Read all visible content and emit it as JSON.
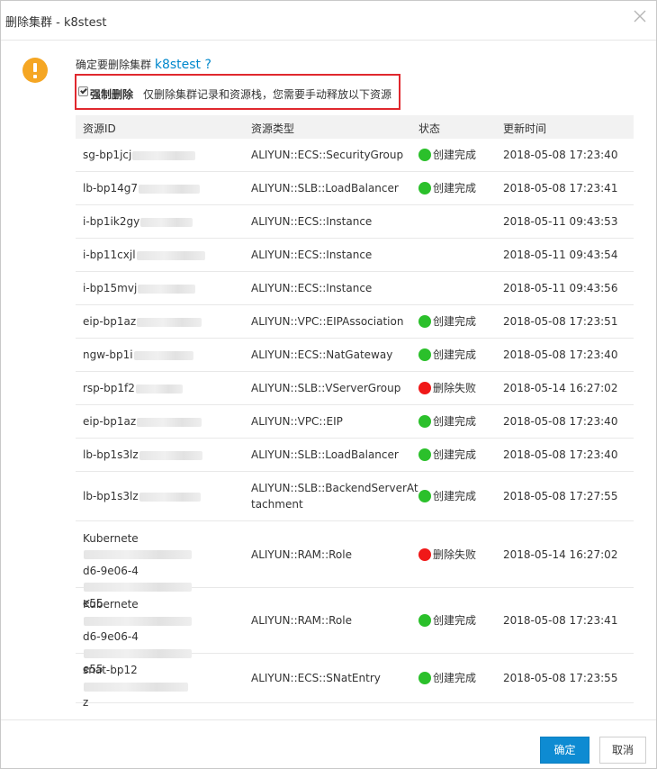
{
  "dialog": {
    "title": "删除集群 - k8stest",
    "question_prefix": "确定要删除集群",
    "cluster_name": "k8stest ?",
    "force_label": "强制删除",
    "force_desc": "仅删除集群记录和资源栈，您需要手动释放以下资源",
    "force_checked": true
  },
  "table": {
    "headers": {
      "id": "资源ID",
      "type": "资源类型",
      "status": "状态",
      "time": "更新时间"
    },
    "rows": [
      {
        "id_lines": [
          "sg-bp1jcj"
        ],
        "type_lines": [
          "ALIYUN::ECS::SecurityGroup"
        ],
        "status": "创建完成",
        "status_kind": "ok",
        "time": "2018-05-08 17:23:40"
      },
      {
        "id_lines": [
          "lb-bp14g7"
        ],
        "type_lines": [
          "ALIYUN::SLB::LoadBalancer"
        ],
        "status": "创建完成",
        "status_kind": "ok",
        "time": "2018-05-08 17:23:41"
      },
      {
        "id_lines": [
          "i-bp1ik2gy"
        ],
        "type_lines": [
          "ALIYUN::ECS::Instance"
        ],
        "status": "",
        "status_kind": "none",
        "time": "2018-05-11 09:43:53"
      },
      {
        "id_lines": [
          "i-bp11cxjl"
        ],
        "type_lines": [
          "ALIYUN::ECS::Instance"
        ],
        "status": "",
        "status_kind": "none",
        "time": "2018-05-11 09:43:54"
      },
      {
        "id_lines": [
          "i-bp15mvj"
        ],
        "type_lines": [
          "ALIYUN::ECS::Instance"
        ],
        "status": "",
        "status_kind": "none",
        "time": "2018-05-11 09:43:56"
      },
      {
        "id_lines": [
          "eip-bp1az"
        ],
        "type_lines": [
          "ALIYUN::VPC::EIPAssociation"
        ],
        "status": "创建完成",
        "status_kind": "ok",
        "time": "2018-05-08 17:23:51"
      },
      {
        "id_lines": [
          "ngw-bp1i"
        ],
        "type_lines": [
          "ALIYUN::ECS::NatGateway"
        ],
        "status": "创建完成",
        "status_kind": "ok",
        "time": "2018-05-08 17:23:40"
      },
      {
        "id_lines": [
          "rsp-bp1f2"
        ],
        "type_lines": [
          "ALIYUN::SLB::VServerGroup"
        ],
        "status": "删除失败",
        "status_kind": "fail",
        "time": "2018-05-14 16:27:02"
      },
      {
        "id_lines": [
          "eip-bp1az"
        ],
        "type_lines": [
          "ALIYUN::VPC::EIP"
        ],
        "status": "创建完成",
        "status_kind": "ok",
        "time": "2018-05-08 17:23:40"
      },
      {
        "id_lines": [
          "lb-bp1s3lz"
        ],
        "type_lines": [
          "ALIYUN::SLB::LoadBalancer"
        ],
        "status": "创建完成",
        "status_kind": "ok",
        "time": "2018-05-08 17:23:40"
      },
      {
        "id_lines": [
          "lb-bp1s3lz"
        ],
        "type_lines": [
          "ALIYUN::SLB::BackendServerAt",
          "tachment"
        ],
        "status": "创建完成",
        "status_kind": "ok",
        "time": "2018-05-08 17:27:55"
      },
      {
        "id_lines": [
          "Kubernete",
          "d6-9e06-4",
          "e55"
        ],
        "type_lines": [
          "ALIYUN::RAM::Role"
        ],
        "status": "删除失败",
        "status_kind": "fail",
        "time": "2018-05-14 16:27:02"
      },
      {
        "id_lines": [
          "Kubernete",
          "d6-9e06-4",
          "e55"
        ],
        "type_lines": [
          "ALIYUN::RAM::Role"
        ],
        "status": "创建完成",
        "status_kind": "ok",
        "time": "2018-05-08 17:23:41"
      },
      {
        "id_lines": [
          "snat-bp12",
          "z"
        ],
        "type_lines": [
          "ALIYUN::ECS::SNatEntry"
        ],
        "status": "创建完成",
        "status_kind": "ok",
        "time": "2018-05-08 17:23:55"
      }
    ]
  },
  "buttons": {
    "ok": "确定",
    "cancel": "取消"
  }
}
